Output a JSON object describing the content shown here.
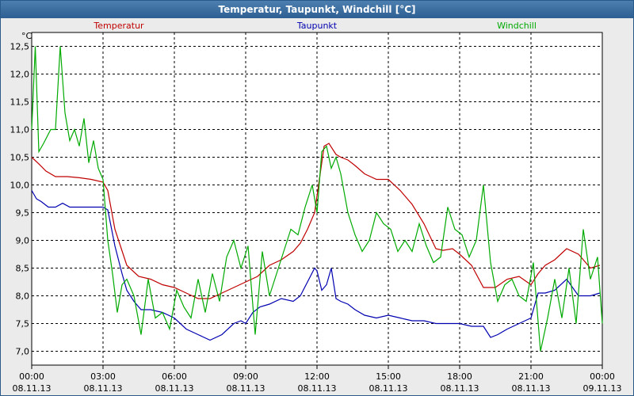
{
  "window": {
    "title": "Temperatur, Taupunkt, Windchill [°C]"
  },
  "chart_data": {
    "type": "line",
    "title": "Temperatur, Taupunkt, Windchill [°C]",
    "ylabel": "°C",
    "ylim": [
      6.75,
      12.75
    ],
    "xlim": [
      0,
      24
    ],
    "grid": true,
    "legend_placement": "top",
    "y_ticks": [
      "12,5",
      "12,0",
      "11,5",
      "11,0",
      "10,5",
      "10,0",
      "9,5",
      "9,0",
      "8,5",
      "8,0",
      "7,5",
      "7,0"
    ],
    "y_tick_values": [
      12.5,
      12.0,
      11.5,
      11.0,
      10.5,
      10.0,
      9.5,
      9.0,
      8.5,
      8.0,
      7.5,
      7.0
    ],
    "x_ticks": [
      {
        "time": "00:00",
        "date": "08.11.13"
      },
      {
        "time": "03:00",
        "date": "08.11.13"
      },
      {
        "time": "06:00",
        "date": "08.11.13"
      },
      {
        "time": "09:00",
        "date": "08.11.13"
      },
      {
        "time": "12:00",
        "date": "08.11.13"
      },
      {
        "time": "15:00",
        "date": "08.11.13"
      },
      {
        "time": "18:00",
        "date": "08.11.13"
      },
      {
        "time": "21:00",
        "date": "08.11.13"
      },
      {
        "time": "00:00",
        "date": "09.11.13"
      }
    ],
    "series": [
      {
        "name": "Temperatur",
        "color": "#c00000",
        "x": [
          0,
          0.3,
          0.6,
          1,
          1.5,
          2,
          2.5,
          3,
          3.2,
          3.5,
          4,
          4.5,
          5,
          5.5,
          6,
          6.5,
          7,
          7.5,
          8,
          8.5,
          9,
          9.5,
          10,
          10.5,
          11,
          11.3,
          11.6,
          11.9,
          12.1,
          12.3,
          12.5,
          12.8,
          13,
          13.3,
          13.6,
          14,
          14.5,
          15,
          15.5,
          16,
          16.5,
          17,
          17.3,
          17.7,
          18,
          18.5,
          19,
          19.5,
          20,
          20.5,
          21,
          21.3,
          21.6,
          22,
          22.5,
          23,
          23.5,
          23.9
        ],
        "y": [
          10.5,
          10.38,
          10.25,
          10.15,
          10.15,
          10.13,
          10.1,
          10.05,
          9.9,
          9.2,
          8.55,
          8.35,
          8.3,
          8.2,
          8.15,
          8.05,
          7.95,
          7.95,
          8.05,
          8.15,
          8.25,
          8.35,
          8.55,
          8.65,
          8.8,
          8.95,
          9.2,
          9.5,
          10.1,
          10.7,
          10.75,
          10.55,
          10.5,
          10.45,
          10.35,
          10.2,
          10.1,
          10.1,
          9.9,
          9.65,
          9.3,
          8.85,
          8.82,
          8.85,
          8.75,
          8.55,
          8.15,
          8.15,
          8.3,
          8.35,
          8.2,
          8.4,
          8.55,
          8.65,
          8.85,
          8.75,
          8.5,
          8.55
        ]
      },
      {
        "name": "Taupunkt",
        "color": "#0000b0",
        "x": [
          0,
          0.2,
          0.4,
          0.7,
          1,
          1.3,
          1.6,
          2,
          2.5,
          3,
          3.2,
          3.5,
          3.8,
          4,
          4.3,
          4.6,
          5,
          5.5,
          6,
          6.5,
          7,
          7.5,
          8,
          8.5,
          8.8,
          9,
          9.3,
          9.6,
          10,
          10.5,
          11,
          11.3,
          11.6,
          11.9,
          12,
          12.2,
          12.4,
          12.6,
          12.8,
          13,
          13.3,
          13.6,
          14,
          14.5,
          15,
          15.5,
          16,
          16.5,
          17,
          17.5,
          18,
          18.5,
          19,
          19.3,
          19.6,
          20,
          20.5,
          21,
          21.3,
          21.6,
          22,
          22.5,
          23,
          23.5,
          23.9
        ],
        "y": [
          9.9,
          9.75,
          9.7,
          9.6,
          9.6,
          9.67,
          9.6,
          9.6,
          9.6,
          9.6,
          9.55,
          8.9,
          8.4,
          8.1,
          7.9,
          7.75,
          7.75,
          7.7,
          7.6,
          7.4,
          7.3,
          7.2,
          7.3,
          7.5,
          7.55,
          7.5,
          7.7,
          7.8,
          7.85,
          7.95,
          7.9,
          8.0,
          8.25,
          8.5,
          8.45,
          8.1,
          8.2,
          8.5,
          7.95,
          7.9,
          7.85,
          7.75,
          7.65,
          7.6,
          7.65,
          7.6,
          7.55,
          7.55,
          7.5,
          7.5,
          7.5,
          7.45,
          7.45,
          7.25,
          7.3,
          7.4,
          7.5,
          7.6,
          8.05,
          8.05,
          8.1,
          8.3,
          8.0,
          8.0,
          8.05
        ]
      },
      {
        "name": "Windchill",
        "color": "#00aa00",
        "x": [
          0,
          0.15,
          0.3,
          0.5,
          0.8,
          1,
          1.2,
          1.4,
          1.6,
          1.8,
          2,
          2.2,
          2.4,
          2.6,
          2.8,
          3,
          3.2,
          3.4,
          3.6,
          3.8,
          4,
          4.3,
          4.6,
          4.9,
          5.2,
          5.5,
          5.8,
          6.1,
          6.4,
          6.7,
          7,
          7.3,
          7.6,
          7.9,
          8.2,
          8.5,
          8.8,
          9.1,
          9.4,
          9.7,
          10,
          10.3,
          10.6,
          10.9,
          11.2,
          11.5,
          11.8,
          12,
          12.2,
          12.4,
          12.6,
          12.8,
          13,
          13.3,
          13.6,
          13.9,
          14.2,
          14.5,
          14.8,
          15.1,
          15.4,
          15.7,
          16,
          16.3,
          16.6,
          16.9,
          17.2,
          17.5,
          17.8,
          18.1,
          18.4,
          18.7,
          19,
          19.3,
          19.6,
          19.9,
          20.2,
          20.5,
          20.8,
          21.1,
          21.4,
          21.7,
          22,
          22.3,
          22.6,
          22.9,
          23.2,
          23.5,
          23.8,
          24
        ],
        "y": [
          11.0,
          12.5,
          10.6,
          10.75,
          11.0,
          11.0,
          12.5,
          11.3,
          10.8,
          11.0,
          10.7,
          11.2,
          10.4,
          10.8,
          10.3,
          10.1,
          9.0,
          8.4,
          7.7,
          8.2,
          8.3,
          8.0,
          7.3,
          8.3,
          7.6,
          7.7,
          7.4,
          8.1,
          7.8,
          7.6,
          8.3,
          7.7,
          8.4,
          7.9,
          8.7,
          9.0,
          8.5,
          8.9,
          7.3,
          8.8,
          8.0,
          8.4,
          8.8,
          9.2,
          9.1,
          9.6,
          10.0,
          9.5,
          10.6,
          10.7,
          10.3,
          10.5,
          10.2,
          9.5,
          9.1,
          8.8,
          9.0,
          9.5,
          9.3,
          9.2,
          8.8,
          9.0,
          8.8,
          9.3,
          8.9,
          8.6,
          8.7,
          9.6,
          9.2,
          9.1,
          8.7,
          9.0,
          10.0,
          8.6,
          7.9,
          8.2,
          8.3,
          8.0,
          7.9,
          8.6,
          7.0,
          7.6,
          8.3,
          7.6,
          8.5,
          7.5,
          9.2,
          8.3,
          8.7,
          7.5
        ]
      }
    ]
  }
}
